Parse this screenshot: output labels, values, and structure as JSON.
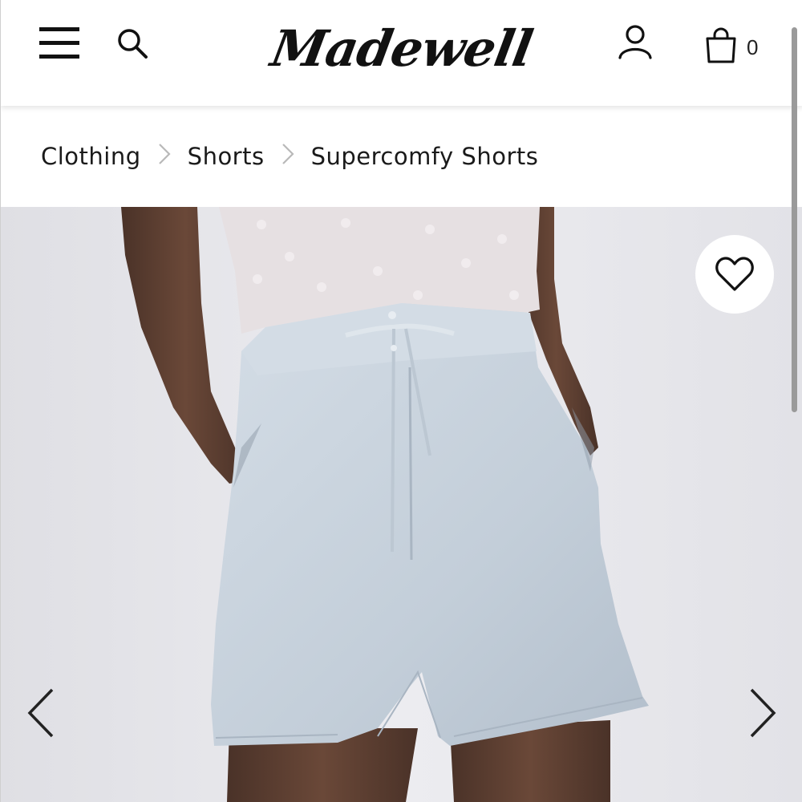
{
  "header": {
    "logo_text": "Madewell",
    "bag_count": "0",
    "icons": {
      "menu": "hamburger-menu-icon",
      "search": "search-icon",
      "account": "account-icon",
      "bag": "shopping-bag-icon"
    }
  },
  "breadcrumb": {
    "items": [
      "Clothing",
      "Shorts",
      "Supercomfy Shorts"
    ]
  },
  "product_gallery": {
    "icons": {
      "favorite": "heart-icon",
      "prev": "chevron-left-icon",
      "next": "chevron-right-icon"
    }
  },
  "colors": {
    "background": "#ffffff",
    "text": "#1a1a1a",
    "photo_background": "#e6e6ea",
    "shorts": "#c9d3dd",
    "breadcrumb_separator": "#b9b9b9"
  }
}
